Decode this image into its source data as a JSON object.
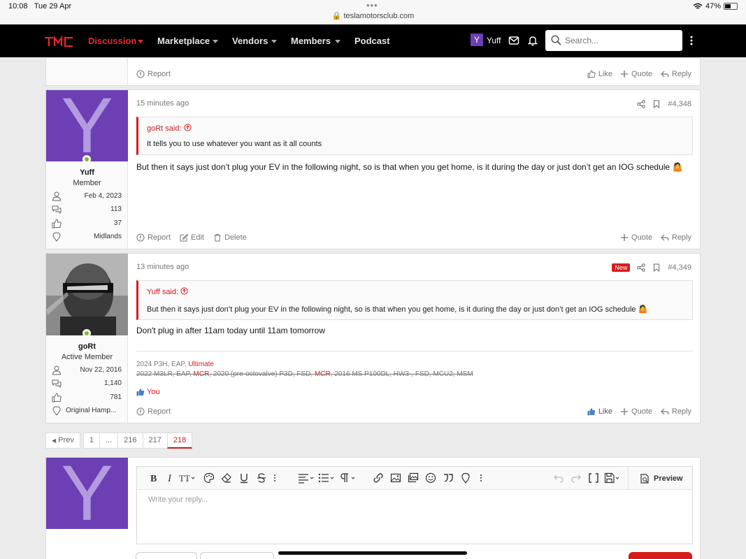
{
  "status_bar": {
    "time": "10:08",
    "date": "Tue 29 Apr",
    "url": "teslamotorsclub.com",
    "battery": "47%"
  },
  "nav": {
    "logo_text": "TMC",
    "items": [
      {
        "label": "Discussion",
        "active": true
      },
      {
        "label": "Marketplace"
      },
      {
        "label": "Vendors"
      },
      {
        "label": "Members"
      },
      {
        "label": "Podcast"
      }
    ],
    "user_initial": "Y",
    "username": "Yuff",
    "search_placeholder": "Search..."
  },
  "top_actions": {
    "report": "Report",
    "like": "Like",
    "quote": "Quote",
    "reply": "Reply"
  },
  "posts": [
    {
      "avatar_initial": "Y",
      "username": "Yuff",
      "user_title": "Member",
      "joined": "Feb 4, 2023",
      "messages": "113",
      "reactions": "37",
      "location": "Midlands",
      "time": "15 minutes ago",
      "post_number": "#4,348",
      "quote_author": "goRt said:",
      "quote_text": "It tells you to use whatever you want as it all counts",
      "body": "But then it says just don’t plug your EV in the following night, so is that when you get home, is it during the day or just don’t get an IOG schedule 🤷",
      "actions": {
        "report": "Report",
        "edit": "Edit",
        "delete": "Delete",
        "quote": "Quote",
        "reply": "Reply"
      }
    },
    {
      "username": "goRt",
      "user_title": "Active Member",
      "joined": "Nov 22, 2016",
      "messages": "1,140",
      "reactions": "781",
      "location": "Original Hamp...",
      "time": "13 minutes ago",
      "new_badge": "New",
      "post_number": "#4,349",
      "quote_author": "Yuff said:",
      "quote_text": "But then it says just don’t plug your EV in the following night, so is that when you get home, is it during the day or just don’t get an IOG schedule 🤷",
      "body": "Don't plug in after 11am today until 11am tomorrow",
      "signature": {
        "line1_plain": "2024 P3H, EAP, ",
        "line1_red": "Ultimate",
        "line2_a": "2022 M3LR, EAP, ",
        "line2_red1": "MCR",
        "line2_b": ", 2020 (pre-octovalve) P3D, FSD, ",
        "line2_red2": "MCR",
        "line2_c": ", 2016 MS P100DL, HW3-, FSD, MCU2, MSM"
      },
      "reaction_text": "You",
      "actions": {
        "report": "Report",
        "like": "Like",
        "quote": "Quote",
        "reply": "Reply"
      }
    }
  ],
  "pagination": {
    "prev": "Prev",
    "pages": [
      "1",
      "...",
      "216",
      "217",
      "218"
    ],
    "current": "218"
  },
  "reply": {
    "avatar_initial": "Y",
    "placeholder": "Write your reply...",
    "preview_label": "Preview"
  },
  "colors": {
    "brand_red": "#e8262b",
    "avatar_purple": "#6d3fb5",
    "online_green": "#7cb82f"
  }
}
